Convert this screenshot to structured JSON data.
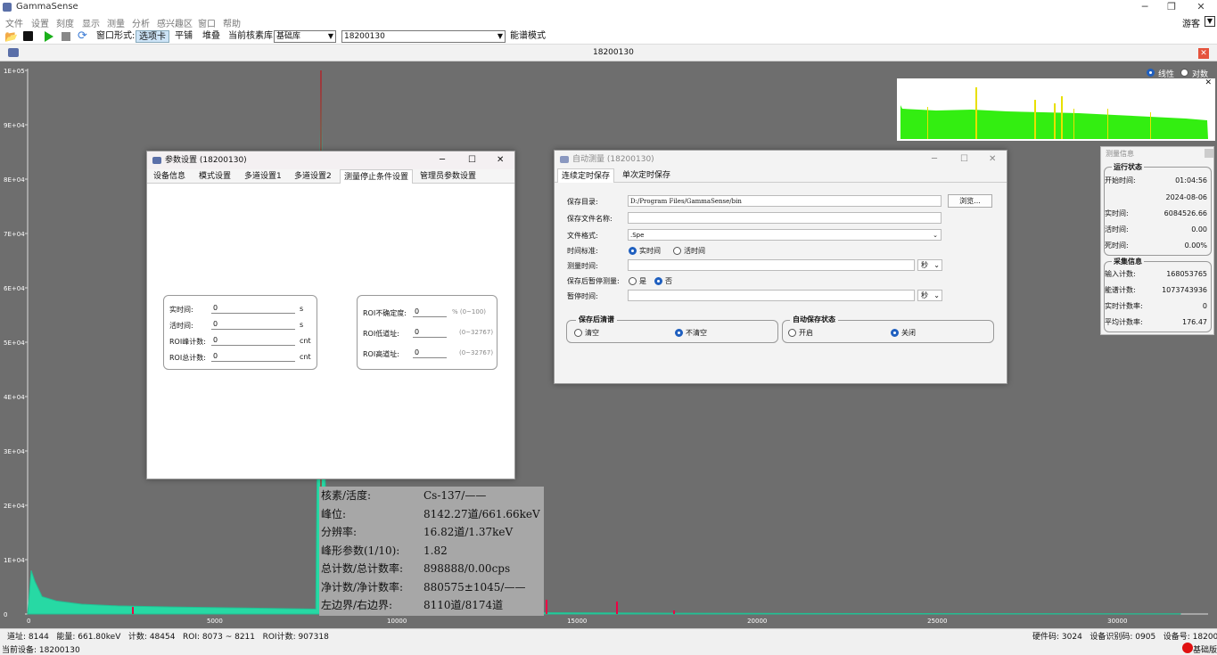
{
  "app": {
    "title": "GammaSense"
  },
  "menu": [
    "文件",
    "设置",
    "刻度",
    "显示",
    "测量",
    "分析",
    "感兴趣区",
    "窗口",
    "帮助"
  ],
  "user": {
    "name": "游客"
  },
  "toolbar": {
    "window_mode_label": "窗口形式:",
    "modes": [
      "选项卡",
      "平铺",
      "堆叠"
    ],
    "library_label": "当前核素库:",
    "library_value": "基础库",
    "device_value": "18200130",
    "spectrum_mode": "能谱模式"
  },
  "doc_tab": {
    "title": "18200130"
  },
  "plot": {
    "scale_options": [
      "线性",
      "对数"
    ],
    "y_ticks": [
      "1E+05",
      "9E+04",
      "8E+04",
      "7E+04",
      "6E+04",
      "5E+04",
      "4E+04",
      "3E+04",
      "2E+04",
      "1E+04",
      "0"
    ],
    "x_ticks": [
      "0",
      "5000",
      "10000",
      "15000",
      "20000",
      "25000",
      "30000"
    ],
    "peak_info": [
      {
        "k": "核素/活度:",
        "v": "Cs-137/——"
      },
      {
        "k": "峰位:",
        "v": "8142.27道/661.66keV"
      },
      {
        "k": "分辨率:",
        "v": "16.82道/1.37keV"
      },
      {
        "k": "峰形参数(1/10):",
        "v": "1.82"
      },
      {
        "k": "总计数/总计数率:",
        "v": "898888/0.00cps"
      },
      {
        "k": "净计数/净计数率:",
        "v": "880575±1045/——"
      },
      {
        "k": "左边界/右边界:",
        "v": "8110道/8174道"
      }
    ]
  },
  "chart_data": {
    "type": "area",
    "xlabel": "",
    "ylabel": "",
    "xlim": [
      0,
      32768
    ],
    "ylim": [
      0,
      100000
    ],
    "x": [
      0,
      100,
      200,
      400,
      800,
      1500,
      2500,
      4000,
      6000,
      8000,
      8142,
      8300,
      10000,
      12000,
      14000,
      16000,
      18000,
      20000,
      24000,
      28000,
      32000
    ],
    "values": [
      0,
      8000,
      6000,
      3200,
      2400,
      1800,
      1500,
      1300,
      1100,
      900,
      98000,
      700,
      400,
      300,
      250,
      200,
      150,
      120,
      90,
      60,
      30
    ],
    "marker_channel": 8142
  },
  "param_dialog": {
    "title": "参数设置 (18200130)",
    "tabs": [
      "设备信息",
      "模式设置",
      "多道设置1",
      "多道设置2",
      "测量停止条件设置",
      "管理员参数设置"
    ],
    "left_fields": [
      {
        "label": "实时间:",
        "value": "0",
        "unit": "s"
      },
      {
        "label": "活时间:",
        "value": "0",
        "unit": "s"
      },
      {
        "label": "ROI峰计数:",
        "value": "0",
        "unit": "cnt"
      },
      {
        "label": "ROI总计数:",
        "value": "0",
        "unit": "cnt"
      }
    ],
    "right_fields": [
      {
        "label": "ROI不确定度:",
        "value": "0",
        "unit": "% (0~100)"
      },
      {
        "label": "ROI低道址:",
        "value": "0",
        "unit": "(0~32767)"
      },
      {
        "label": "ROI高道址:",
        "value": "0",
        "unit": "(0~32767)"
      }
    ]
  },
  "auto_dialog": {
    "title": "自动测量 (18200130)",
    "tabs": [
      "连续定时保存",
      "单次定时保存"
    ],
    "save_dir_label": "保存目录:",
    "save_dir_value": "D:/Program Files/GammaSense/bin",
    "browse": "浏览...",
    "file_name_label": "保存文件名称:",
    "file_name_value": "",
    "format_label": "文件格式:",
    "format_value": ".Spe",
    "time_std_label": "时间标准:",
    "time_std_options": [
      "实时间",
      "活时间"
    ],
    "meas_time_label": "测量时间:",
    "meas_time_unit": "秒",
    "pause_after_label": "保存后暂停测量:",
    "pause_after_options": [
      "是",
      "否"
    ],
    "pause_time_label": "暂停时间:",
    "pause_time_unit": "秒",
    "clear_group": {
      "title": "保存后清谱",
      "options": [
        "清空",
        "不清空"
      ]
    },
    "auto_group": {
      "title": "自动保存状态",
      "options": [
        "开启",
        "关闭"
      ]
    }
  },
  "measure_info": {
    "title": "测量信息",
    "run_title": "运行状态",
    "run": [
      {
        "k": "开始时间:",
        "v": "01:04:56"
      },
      {
        "k": "",
        "v": "2024-08-06"
      },
      {
        "k": "实时间:",
        "v": "6084526.66"
      },
      {
        "k": "活时间:",
        "v": "0.00"
      },
      {
        "k": "死时间:",
        "v": "0.00%"
      }
    ],
    "acq_title": "采集信息",
    "acq": [
      {
        "k": "输入计数:",
        "v": "168053765"
      },
      {
        "k": "能谱计数:",
        "v": "1073743936"
      },
      {
        "k": "实时计数率:",
        "v": "0"
      },
      {
        "k": "平均计数率:",
        "v": "176.47"
      }
    ]
  },
  "status": {
    "left": "道址: 8144   能量: 661.80keV   计数: 48454   ROI: 8073 ~ 8211   ROI计数: 907318",
    "right": "硬件码: 3024   设备识别码: 0905   设备号: 18200130",
    "current_device": "当前设备: 18200130",
    "lib": "基础版"
  }
}
